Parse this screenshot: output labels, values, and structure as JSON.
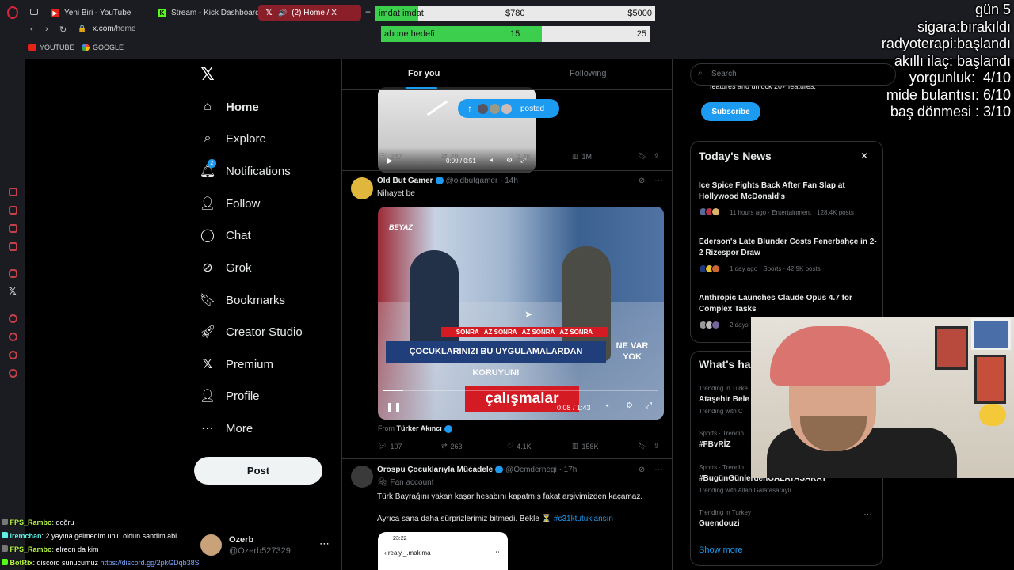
{
  "browser": {
    "tabs": [
      {
        "label": "Yeni Biri - YouTube",
        "icon": "youtube-icon"
      },
      {
        "label": "Stream - Kick Dashboard",
        "icon": "kick-icon"
      },
      {
        "label": "(2) Home / X",
        "icon": "x-icon"
      }
    ],
    "url_host": "x.com",
    "url_path": "/home",
    "bookmarks": [
      "YOUTUBE",
      "GOOGLE"
    ]
  },
  "overlay": {
    "donation_bar": {
      "label": "imdat imdat",
      "current": "$780",
      "goal": "$5000",
      "fraction": 0.156
    },
    "sub_bar": {
      "label": "abone hedefi",
      "current": "15",
      "goal": "25",
      "fraction": 0.6
    },
    "stats": [
      "gün 5",
      "sigara:bırakıldı",
      "radyoterapi:başlandı",
      "akıllı ilaç: başlandı",
      "yorgunluk:  4/10",
      "mide bulantısı: 6/10",
      "baş dönmesi : 3/10"
    ]
  },
  "nav": {
    "items": [
      {
        "label": "Home",
        "icon": "home-icon"
      },
      {
        "label": "Explore",
        "icon": "search-icon"
      },
      {
        "label": "Notifications",
        "icon": "bell-icon",
        "badge": "2"
      },
      {
        "label": "Follow",
        "icon": "follow-icon"
      },
      {
        "label": "Chat",
        "icon": "chat-icon"
      },
      {
        "label": "Grok",
        "icon": "grok-icon"
      },
      {
        "label": "Bookmarks",
        "icon": "bookmark-icon"
      },
      {
        "label": "Creator Studio",
        "icon": "rocket-icon"
      },
      {
        "label": "Premium",
        "icon": "x-icon"
      },
      {
        "label": "Profile",
        "icon": "person-icon"
      },
      {
        "label": "More",
        "icon": "more-icon"
      }
    ],
    "post_label": "Post"
  },
  "account": {
    "name": "Ozerb",
    "handle": "@Ozerb527329"
  },
  "chat": [
    {
      "user": "FPS_Rambo",
      "text": ": doğru",
      "color": "#b6f542"
    },
    {
      "user": "iremchan",
      "text": ": 2 yayına gelmedim unlu oldun sandim abi",
      "color": "#5bf0e8"
    },
    {
      "user": "FPS_Rambo",
      "text": ": elreon da kim",
      "color": "#b6f542"
    },
    {
      "user": "BotRix",
      "text": ": discord sunucumuz ",
      "link": "https://discord.gg/2pkGDqb38S",
      "color": "#b6f542"
    }
  ],
  "timeline": {
    "tabs": [
      "For you",
      "Following"
    ],
    "tweet0": {
      "posted_label": "posted",
      "video_time": "0:09 / 0:51",
      "replies": "247",
      "reposts": "49",
      "likes": "2.4K",
      "views": "1M"
    },
    "tweet1": {
      "name": "Old But Gamer",
      "handle": "@oldbutgamer · 14h",
      "text": "Nihayet be",
      "video_time": "0:08 / 1:43",
      "video_channel": "BEYAZ",
      "video_banner": "ÇOCUKLARINIZI BU UYGULAMALARDAN KORUYUN!",
      "video_ticker": "SONRA   AZ SONRA   AZ SONRA   AZ SONRA",
      "video_logo": "NE VAR YOK",
      "video_caption": "çalışmalar",
      "from_prefix": "From",
      "from_name": "Türker Akıncı",
      "replies": "107",
      "reposts": "263",
      "likes": "4.1K",
      "views": "158K"
    },
    "tweet2": {
      "name": "Orospu Çocuklarıyla Mücadele",
      "handle": "@Ocmdernegi · 17h",
      "account_type": "Fan account",
      "text1": "Türk Bayrağını yakan kaşar hesabını kapatmış fakat arşivimizden kaçamaz.",
      "text2": "Ayrıca sana daha sürprizlerimiz bitmedi. Bekle ⏳ ",
      "hashtag": "#c31ktutuklansın",
      "phone_time": "23:22",
      "phone_user": "realy._.makima"
    }
  },
  "sidebar": {
    "search_placeholder": "Search",
    "premium_text": "features and unlock 20+ features.",
    "subscribe_label": "Subscribe",
    "news_title": "Today's News",
    "news": [
      {
        "title": "Ice Spice Fights Back After Fan Slap at Hollywood McDonald's",
        "meta": "11 hours ago · Entertainment · 128.4K posts"
      },
      {
        "title": "Ederson's Late Blunder Costs Fenerbahçe in 2-2 Rizespor Draw",
        "meta": "1 day ago · Sports · 42.9K posts"
      },
      {
        "title": "Anthropic Launches Claude Opus 4.7 for Complex Tasks",
        "meta": "2 days"
      }
    ],
    "happening_title": "What's ha",
    "trends": [
      {
        "ctx": "Trending in Turke",
        "name": "Ataşehir Bele",
        "sub": "Trending with C"
      },
      {
        "ctx": "Sports · Trendin",
        "name": "#FBvRİZ",
        "sub": ""
      },
      {
        "ctx": "Sports · Trendin",
        "name": "#BugünGünlerdenGALATASARAY",
        "sub": "Trending with Allah Galatasaraylı"
      },
      {
        "ctx": "Trending in Turkey",
        "name": "Guendouzi",
        "sub": ""
      }
    ],
    "show_more": "Show more"
  }
}
